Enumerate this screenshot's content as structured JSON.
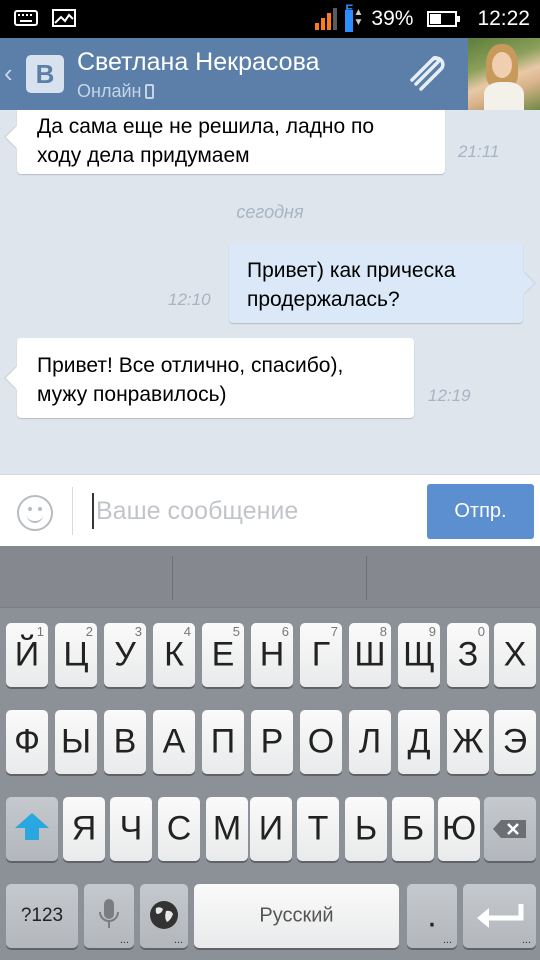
{
  "status_bar": {
    "battery": "39%",
    "time": "12:22",
    "network_icon": "signal-bars-icon"
  },
  "header": {
    "back_icon": "chevron-left-icon",
    "logo_text": "В",
    "name": "Светлана Некрасова",
    "status": "Онлайн",
    "status_icon": "mobile-phone-icon",
    "attach_icon": "paperclip-icon",
    "avatar_icon": "contact-avatar"
  },
  "messages": [
    {
      "direction": "in",
      "lines": [
        "Да сама еще не решила, ладно по",
        "ходу дела придумаем"
      ],
      "time": "21:11"
    },
    {
      "direction": "out",
      "lines": [
        "Привет) как прическа",
        "продержалась?"
      ],
      "time": "12:10"
    },
    {
      "direction": "in",
      "lines": [
        "Привет! Все отлично, спасибо),",
        "мужу понравилось)"
      ],
      "time": "12:19"
    }
  ],
  "date_separator": "сегодня",
  "composer": {
    "placeholder": "Ваше сообщение",
    "value": "",
    "send_label": "Отпр.",
    "emoji_icon": "smiley-icon"
  },
  "keyboard": {
    "row1": [
      {
        "label": "Й",
        "hint": "1"
      },
      {
        "label": "Ц",
        "hint": "2"
      },
      {
        "label": "У",
        "hint": "3"
      },
      {
        "label": "К",
        "hint": "4"
      },
      {
        "label": "Е",
        "hint": "5"
      },
      {
        "label": "Н",
        "hint": "6"
      },
      {
        "label": "Г",
        "hint": "7"
      },
      {
        "label": "Ш",
        "hint": "8"
      },
      {
        "label": "Щ",
        "hint": "9"
      },
      {
        "label": "З",
        "hint": "0"
      },
      {
        "label": "Х",
        "hint": ""
      }
    ],
    "row2": [
      "Ф",
      "Ы",
      "В",
      "А",
      "П",
      "Р",
      "О",
      "Л",
      "Д",
      "Ж",
      "Э"
    ],
    "row3": [
      "Я",
      "Ч",
      "С",
      "М",
      "И",
      "Т",
      "Ь",
      "Б",
      "Ю"
    ],
    "symbols_label": "?123",
    "space_label": "Русский",
    "period_label": ".",
    "shift_icon": "shift-icon",
    "backspace_icon": "backspace-icon",
    "mic_icon": "microphone-icon",
    "globe_icon": "globe-icon",
    "enter_icon": "enter-arrow-icon"
  }
}
